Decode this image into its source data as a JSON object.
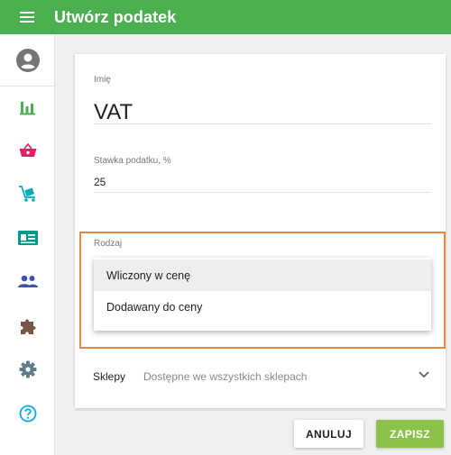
{
  "appbar": {
    "title": "Utwórz podatek",
    "color": "#4caf50"
  },
  "sidebar": {
    "items": [
      {
        "icon": "account-circle-icon",
        "color": "#757575"
      },
      {
        "icon": "bar-chart-icon",
        "color": "#4caf50"
      },
      {
        "icon": "basket-icon",
        "color": "#e91e63"
      },
      {
        "icon": "cart-icon",
        "color": "#00acc1"
      },
      {
        "icon": "id-card-icon",
        "color": "#009688"
      },
      {
        "icon": "people-icon",
        "color": "#3f51b5"
      },
      {
        "icon": "puzzle-icon",
        "color": "#795548"
      },
      {
        "icon": "gear-icon",
        "color": "#607d8b"
      },
      {
        "icon": "help-icon",
        "color": "#03a9f4"
      }
    ]
  },
  "form": {
    "name": {
      "label": "Imię",
      "value": "VAT"
    },
    "rate": {
      "label": "Stawka podatku, %",
      "value": "25"
    },
    "type": {
      "label": "Rodzaj",
      "options": [
        "Wliczony w cenę",
        "Dodawany do ceny"
      ],
      "selected_index": 0
    },
    "shops": {
      "label": "Sklepy",
      "value": "Dostępne we wszystkich sklepach"
    }
  },
  "buttons": {
    "cancel": "ANULUJ",
    "save": "ZAPISZ"
  },
  "colors": {
    "accent": "#8bc34a",
    "highlight": "#e8883a"
  }
}
